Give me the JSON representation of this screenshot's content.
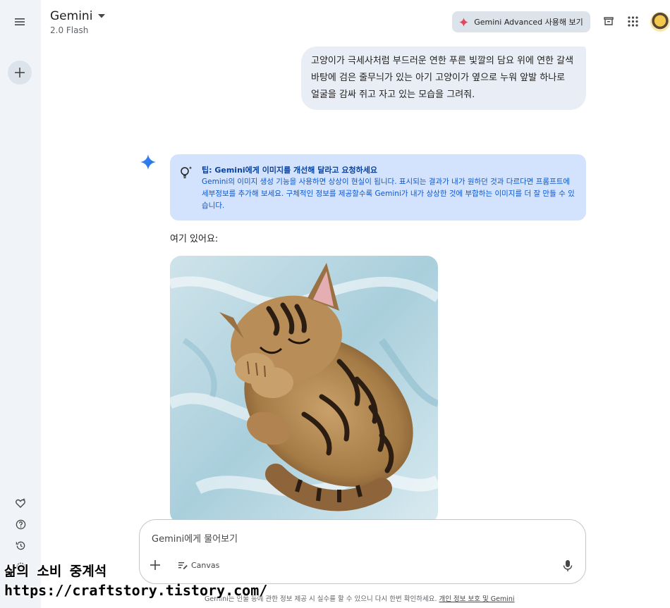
{
  "app": {
    "title": "Gemini",
    "model": "2.0 Flash",
    "advanced_button": "Gemini Advanced 사용해 보기"
  },
  "conversation": {
    "user_prompt": "고양이가 극세사처럼 부드러운 연한 푸른 빛깔의 담요 위에 연한 갈색 바탕에 검은 줄무늬가 있는 아기 고양이가 옆으로 누워 앞발 하나로 얼굴을 감싸 쥐고 자고 있는 모습을 그려줘.",
    "tip_title": "팁: Gemini에게 이미지를 개선해 달라고 요청하세요",
    "tip_body": "Gemini의 이미지 생성 기능을 사용하면 상상이 현실이 됩니다. 표시되는 결과가 내가 원하던 것과 다르다면 프롬프트에 세부정보를 추가해 보세요. 구체적인 정보를 제공할수록 Gemini가 내가 상상한 것에 부합하는 이미지를 더 잘 만들 수 있습니다.",
    "answer": "여기 있어요:"
  },
  "input": {
    "placeholder": "Gemini에게 물어보기",
    "canvas_label": "Canvas"
  },
  "footer": {
    "text": "Gemini는 인물 등에 관한 정보 제공 시 실수를 할 수 있으니 다시 한번 확인하세요. ",
    "link": "개인 정보 보호 및 Gemini"
  },
  "watermark": {
    "line1": "삶의 소비 중계석",
    "line2": "https://craftstory.tistory.com/"
  },
  "colors": {
    "sidebar_bg": "#f0f4f9",
    "tip_bg": "#d3e3fd",
    "user_bubble_bg": "#e9eef6",
    "accent_blue": "#0b57d0"
  }
}
